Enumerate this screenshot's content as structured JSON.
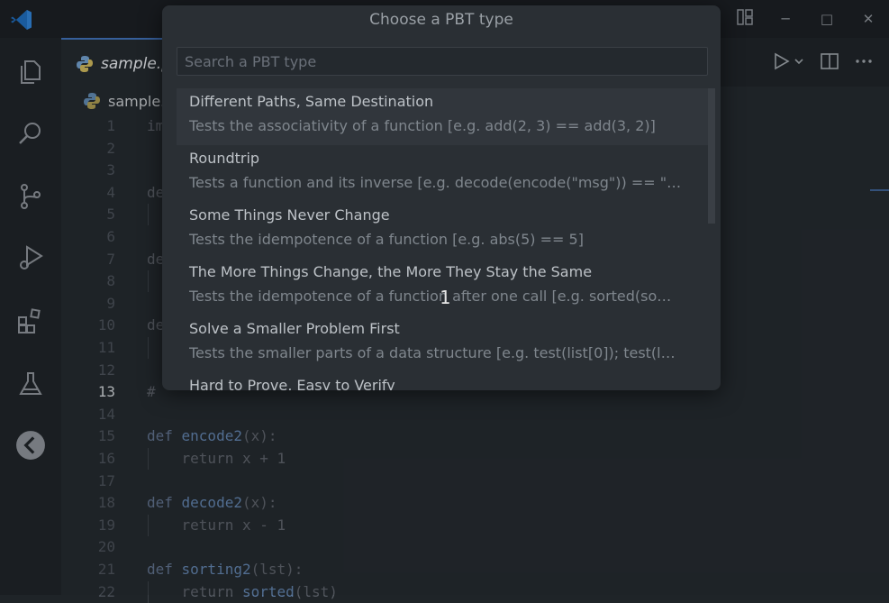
{
  "window": {
    "controls": {
      "minimize": "─",
      "maximize": "□",
      "close": "✕"
    }
  },
  "editor": {
    "tab_label": "sample.p",
    "breadcrumb": "sample."
  },
  "code_lines": [
    {
      "num": "1",
      "text": "im"
    },
    {
      "num": "2",
      "text": ""
    },
    {
      "num": "3",
      "text": ""
    },
    {
      "num": "4",
      "text": "de"
    },
    {
      "num": "5",
      "text": ""
    },
    {
      "num": "6",
      "text": ""
    },
    {
      "num": "7",
      "text": "de"
    },
    {
      "num": "8",
      "text": ""
    },
    {
      "num": "9",
      "text": ""
    },
    {
      "num": "10",
      "text": "de"
    },
    {
      "num": "11",
      "text": ""
    },
    {
      "num": "12",
      "text": ""
    },
    {
      "num": "13",
      "text": "#"
    },
    {
      "num": "14",
      "text": ""
    },
    {
      "num": "15",
      "kw": "def ",
      "fn": "encode2",
      "rest": "(x):"
    },
    {
      "num": "16",
      "text": "    return x + 1"
    },
    {
      "num": "17",
      "text": ""
    },
    {
      "num": "18",
      "kw": "def ",
      "fn": "decode2",
      "rest": "(x):"
    },
    {
      "num": "19",
      "text": "    return x - 1"
    },
    {
      "num": "20",
      "text": ""
    },
    {
      "num": "21",
      "kw": "def ",
      "fn": "sorting2",
      "rest": "(lst):"
    },
    {
      "num": "22",
      "pre": "    return ",
      "fn": "sorted",
      "rest": "(lst)"
    }
  ],
  "quick_pick": {
    "title": "Choose a PBT type",
    "placeholder": "Search a PBT type",
    "items": [
      {
        "label": "Different Paths, Same Destination",
        "desc": "Tests the associativity of a function [e.g. add(2, 3) == add(3, 2)]"
      },
      {
        "label": "Roundtrip",
        "desc": "Tests a function and its inverse [e.g. decode(encode(\"msg\")) == \"…"
      },
      {
        "label": "Some Things Never Change",
        "desc": "Tests the idempotence of a function [e.g. abs(5) == 5]"
      },
      {
        "label": "The More Things Change, the More They Stay the Same",
        "desc": "Tests the idempotence of a function after one call [e.g. sorted(so…"
      },
      {
        "label": "Solve a Smaller Problem First",
        "desc": "Tests the smaller parts of a data structure [e.g. test(list[0]); test(l…"
      },
      {
        "label": "Hard to Prove, Easy to Verify",
        "desc": ""
      }
    ]
  },
  "cursor_text": "1"
}
